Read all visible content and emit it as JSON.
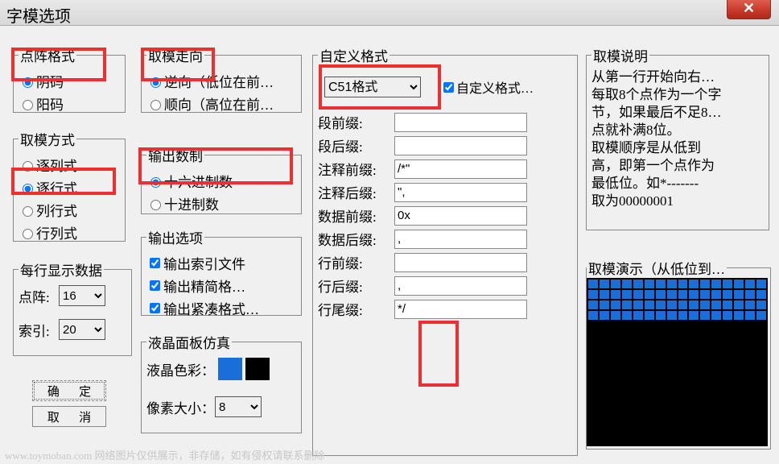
{
  "window": {
    "title": "字模选项"
  },
  "groups": {
    "dotFormat": {
      "legend": "点阵格式",
      "options": [
        "阴码",
        "阳码"
      ],
      "selected": 0
    },
    "scanMode": {
      "legend": "取模方式",
      "options": [
        "逐列式",
        "逐行式",
        "列行式",
        "行列式"
      ],
      "selected": 1
    },
    "perLine": {
      "legend": "每行显示数据",
      "dotLabel": "点阵:",
      "dotValue": "16",
      "indexLabel": "索引:",
      "indexValue": "20"
    },
    "direction": {
      "legend": "取模走向",
      "options": [
        "逆向（低位在前…",
        "顺向（高位在前…"
      ],
      "selected": 0
    },
    "numberBase": {
      "legend": "输出数制",
      "options": [
        "十六进制数",
        "十进制数"
      ],
      "selected": 0
    },
    "outputOptions": {
      "legend": "输出选项",
      "items": [
        "输出索引文件",
        "输出精简格…",
        "输出紧凑格式…"
      ]
    },
    "lcdSim": {
      "legend": "液晶面板仿真",
      "colorLabel": "液晶色彩：",
      "sizeLabel": "像素大小：",
      "sizeValue": "8",
      "color1": "#1a6ed8",
      "color2": "#000000"
    },
    "customFormat": {
      "legend": "自定义格式",
      "dropdown": "C51格式",
      "checkbox": "自定义格式…",
      "fields": [
        {
          "label": "段前缀:",
          "value": ""
        },
        {
          "label": "段后缀:",
          "value": ""
        },
        {
          "label": "注释前缀:",
          "value": "/*\""
        },
        {
          "label": "注释后缀:",
          "value": "\","
        },
        {
          "label": "数据前缀:",
          "value": "0x"
        },
        {
          "label": "数据后缀:",
          "value": ","
        },
        {
          "label": "行前缀:",
          "value": ""
        },
        {
          "label": "行后缀:",
          "value": ","
        },
        {
          "label": "行尾缀:",
          "value": "*/"
        }
      ]
    },
    "description": {
      "legend": "取模说明",
      "text": "    从第一行开始向右…\n每取8个点作为一个字\n节，如果最后不足8…\n点就补满8位。\n    取模顺序是从低到\n高，即第一个点作为\n最低位。如*-------\n取为00000001"
    },
    "demo": {
      "legend": "取模演示（从低位到…"
    }
  },
  "buttons": {
    "ok": "确  定",
    "cancel": "取  消"
  },
  "watermark": "www.toymoban.com 网络图片仅供展示，非存储，如有侵权请联系删除"
}
